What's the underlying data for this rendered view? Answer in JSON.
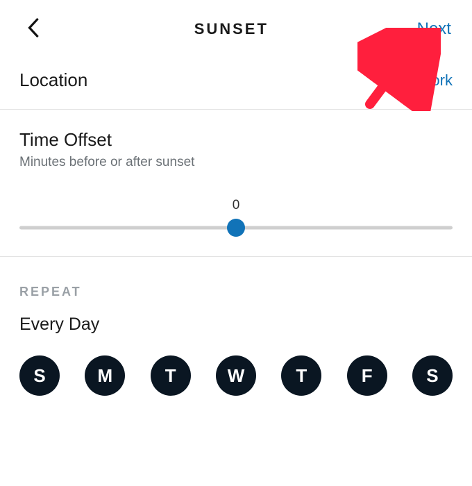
{
  "header": {
    "title": "SUNSET",
    "next_label": "Next"
  },
  "location": {
    "label": "Location",
    "value": "Work"
  },
  "offset": {
    "label": "Time Offset",
    "sub": "Minutes before or after sunset",
    "value": "0"
  },
  "repeat": {
    "section_title": "REPEAT",
    "value_label": "Every Day",
    "days": [
      "S",
      "M",
      "T",
      "W",
      "T",
      "F",
      "S"
    ]
  },
  "colors": {
    "link": "#1173b8",
    "day_bg": "#0a1622"
  }
}
